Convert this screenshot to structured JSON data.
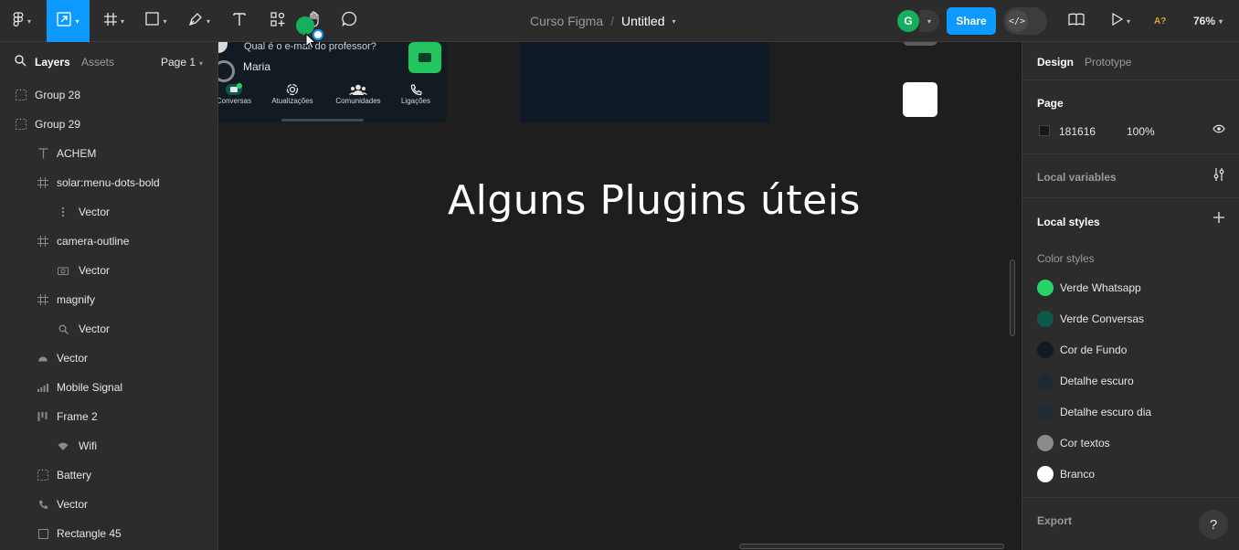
{
  "toolbar": {
    "project": "Curso Figma",
    "separator": "/",
    "file": "Untitled",
    "avatar_initial": "G",
    "share_label": "Share",
    "zoom": "76%",
    "accessibility_badge": "A?"
  },
  "left_panel": {
    "tab_layers": "Layers",
    "tab_assets": "Assets",
    "page_selector": "Page 1",
    "layers": [
      {
        "name": "Group 28",
        "icon": "group-icon"
      },
      {
        "name": "Group 29",
        "icon": "group-icon"
      },
      {
        "name": "ACHEM",
        "icon": "text-icon"
      },
      {
        "name": "solar:menu-dots-bold",
        "icon": "frame-icon"
      },
      {
        "name": "Vector",
        "icon": "menu-dots-icon"
      },
      {
        "name": "camera-outline",
        "icon": "frame-icon"
      },
      {
        "name": "Vector",
        "icon": "camera-icon"
      },
      {
        "name": "magnify",
        "icon": "frame-icon"
      },
      {
        "name": "Vector",
        "icon": "magnify-icon"
      },
      {
        "name": "Vector",
        "icon": "vector-icon"
      },
      {
        "name": "Mobile Signal",
        "icon": "signal-icon"
      },
      {
        "name": "Frame 2",
        "icon": "frame-auto-layout-icon"
      },
      {
        "name": "Wifi",
        "icon": "wifi-icon"
      },
      {
        "name": "Battery",
        "icon": "group-icon"
      },
      {
        "name": "Vector",
        "icon": "phone-icon"
      },
      {
        "name": "Rectangle 45",
        "icon": "rectangle-icon"
      }
    ]
  },
  "canvas": {
    "chat_preview": "Qual é o e-mail do professor?",
    "chat_name": "Maria",
    "nav": [
      "Conversas",
      "Atualizações",
      "Comunidades",
      "Ligações"
    ],
    "nav_badge": "5",
    "headline": "Alguns Plugins úteis"
  },
  "right_panel": {
    "tab_design": "Design",
    "tab_prototype": "Prototype",
    "page_title": "Page",
    "page_color_hex": "181616",
    "page_opacity": "100%",
    "local_variables": "Local variables",
    "local_styles": "Local styles",
    "color_styles_title": "Color styles",
    "color_styles": [
      {
        "name": "Verde Whatsapp",
        "color": "#25d366"
      },
      {
        "name": "Verde Conversas",
        "color": "#0b5a4a"
      },
      {
        "name": "Cor de Fundo",
        "color": "#111b21"
      },
      {
        "name": "Detalhe escuro",
        "color": "#1e2a33"
      },
      {
        "name": "Detalhe escuro dia",
        "color": "#202c33"
      },
      {
        "name": "Cor textos",
        "color": "#8a8a8a"
      },
      {
        "name": "Branco",
        "color": "#ffffff"
      }
    ],
    "export": "Export",
    "help": "?"
  },
  "colors": {
    "accent": "#0d99ff",
    "whatsapp_green": "#22c55e",
    "panel_bg": "#2c2c2c",
    "canvas_bg": "#1e1e1e"
  }
}
